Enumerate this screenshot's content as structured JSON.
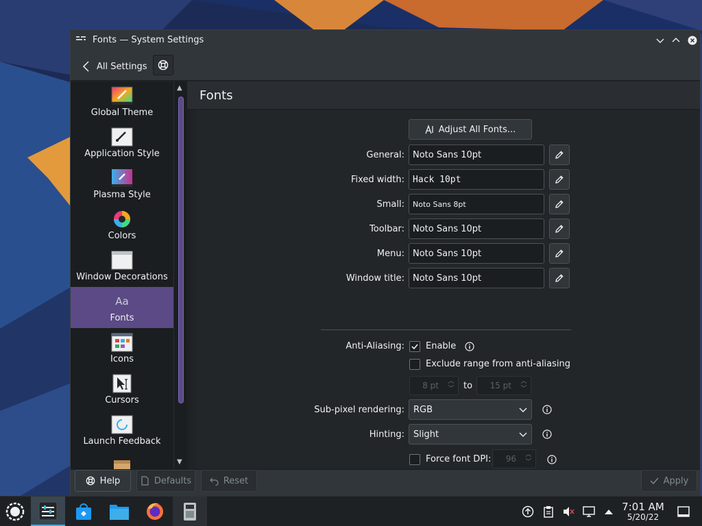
{
  "window": {
    "title": "Fonts — System Settings"
  },
  "toolbar": {
    "back_label": "All Settings"
  },
  "sidebar": {
    "items": [
      {
        "label": "Global Theme",
        "icon": "global-theme-icon"
      },
      {
        "label": "Application Style",
        "icon": "application-style-icon"
      },
      {
        "label": "Plasma Style",
        "icon": "plasma-style-icon"
      },
      {
        "label": "Colors",
        "icon": "colors-icon"
      },
      {
        "label": "Window Decorations",
        "icon": "window-decorations-icon"
      },
      {
        "label": "Fonts",
        "icon": "fonts-icon",
        "icon_text": "Aa",
        "active": true
      },
      {
        "label": "Icons",
        "icon": "icons-icon"
      },
      {
        "label": "Cursors",
        "icon": "cursors-icon"
      },
      {
        "label": "Launch Feedback",
        "icon": "launch-feedback-icon"
      }
    ]
  },
  "page": {
    "title": "Fonts",
    "adjust_all_label": "Adjust All Fonts...",
    "fonts": [
      {
        "label": "General:",
        "value": "Noto Sans 10pt"
      },
      {
        "label": "Fixed width:",
        "value": "Hack 10pt"
      },
      {
        "label": "Small:",
        "value": "Noto Sans 8pt"
      },
      {
        "label": "Toolbar:",
        "value": "Noto Sans 10pt"
      },
      {
        "label": "Menu:",
        "value": "Noto Sans 10pt"
      },
      {
        "label": "Window title:",
        "value": "Noto Sans 10pt"
      }
    ],
    "antialiasing": {
      "label": "Anti-Aliasing:",
      "enable_label": "Enable",
      "enabled": true,
      "exclude_label": "Exclude range from anti-aliasing",
      "exclude_checked": false,
      "range_from": "8 pt",
      "range_to": "15 pt",
      "to_label": "to"
    },
    "subpixel": {
      "label": "Sub-pixel rendering:",
      "value": "RGB"
    },
    "hinting": {
      "label": "Hinting:",
      "value": "Slight"
    },
    "dpi": {
      "label": "Force font DPI:",
      "value": "96",
      "checked": false
    }
  },
  "buttons": {
    "help": "Help",
    "defaults": "Defaults",
    "reset": "Reset",
    "apply": "Apply"
  },
  "clock": {
    "time": "7:01 AM",
    "date": "5/20/22"
  },
  "colors": {
    "accent": "#5b4a85",
    "window_bg": "#232629",
    "sidebar_bg": "#1b1e20",
    "taskbar_active": "#3daee9"
  }
}
